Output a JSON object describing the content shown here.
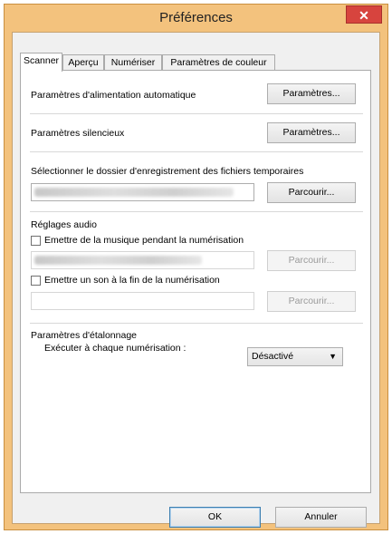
{
  "window": {
    "title": "Préférences",
    "close_glyph": "✕"
  },
  "tabs": [
    {
      "label": "Scanner",
      "active": true
    },
    {
      "label": "Aperçu",
      "active": false
    },
    {
      "label": "Numériser",
      "active": false
    },
    {
      "label": "Paramètres de couleur",
      "active": false
    }
  ],
  "auto_feed": {
    "label": "Paramètres d'alimentation automatique",
    "button": "Paramètres..."
  },
  "silent": {
    "label": "Paramètres silencieux",
    "button": "Paramètres..."
  },
  "temp_folder": {
    "label": "Sélectionner le dossier d'enregistrement des fichiers temporaires",
    "button": "Parcourir..."
  },
  "audio": {
    "heading": "Réglages audio",
    "music_checkbox": "Emettre de la musique pendant la numérisation",
    "music_browse": "Parcourir...",
    "sound_checkbox": "Emettre un son à la fin de la numérisation",
    "sound_browse": "Parcourir..."
  },
  "calibration": {
    "heading": "Paramètres d'étalonnage",
    "label": "Exécuter à chaque numérisation :",
    "selected": "Désactivé"
  },
  "footer": {
    "ok": "OK",
    "cancel": "Annuler"
  }
}
